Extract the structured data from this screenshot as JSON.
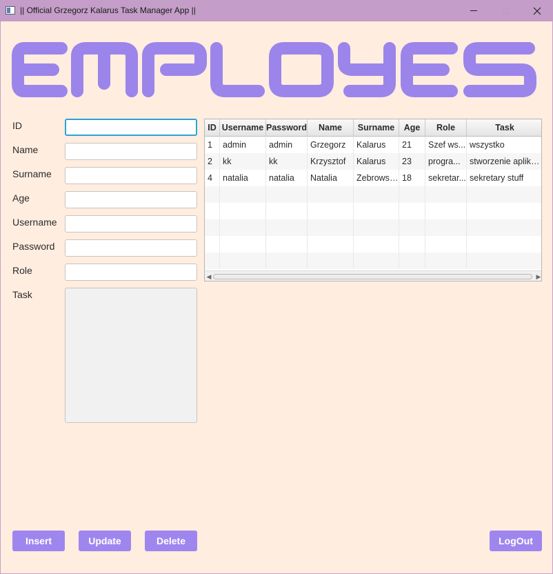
{
  "window": {
    "title": "|| Official Grzegorz Kalarus Task Manager App ||"
  },
  "banner": {
    "text": "EMPLOYEES",
    "color": "#9b85ea"
  },
  "form": {
    "fields": [
      {
        "key": "id",
        "label": "ID",
        "value": ""
      },
      {
        "key": "name",
        "label": "Name",
        "value": ""
      },
      {
        "key": "surname",
        "label": "Surname",
        "value": ""
      },
      {
        "key": "age",
        "label": "Age",
        "value": ""
      },
      {
        "key": "username",
        "label": "Username",
        "value": ""
      },
      {
        "key": "password",
        "label": "Password",
        "value": ""
      },
      {
        "key": "role",
        "label": "Role",
        "value": ""
      },
      {
        "key": "task",
        "label": "Task",
        "value": ""
      }
    ]
  },
  "table": {
    "columns": [
      "ID",
      "Username",
      "Password",
      "Name",
      "Surname",
      "Age",
      "Role",
      "Task"
    ],
    "rows": [
      [
        "1",
        "admin",
        "admin",
        "Grzegorz",
        "Kalarus",
        "21",
        "Szef ws...",
        "wszystko"
      ],
      [
        "2",
        "kk",
        "kk",
        "Krzysztof",
        "Kalarus",
        "23",
        "progra...",
        "stworzenie aplika..."
      ],
      [
        "4",
        "natalia",
        "natalia",
        "Natalia",
        "Zebrowska",
        "18",
        "sekretar...",
        "sekretary stuff"
      ]
    ]
  },
  "buttons": {
    "insert": "Insert",
    "update": "Update",
    "delete": "Delete",
    "logout": "LogOut"
  },
  "colors": {
    "accent": "#9f86ee",
    "background": "#ffede0",
    "titlebar": "#c49dc8"
  }
}
